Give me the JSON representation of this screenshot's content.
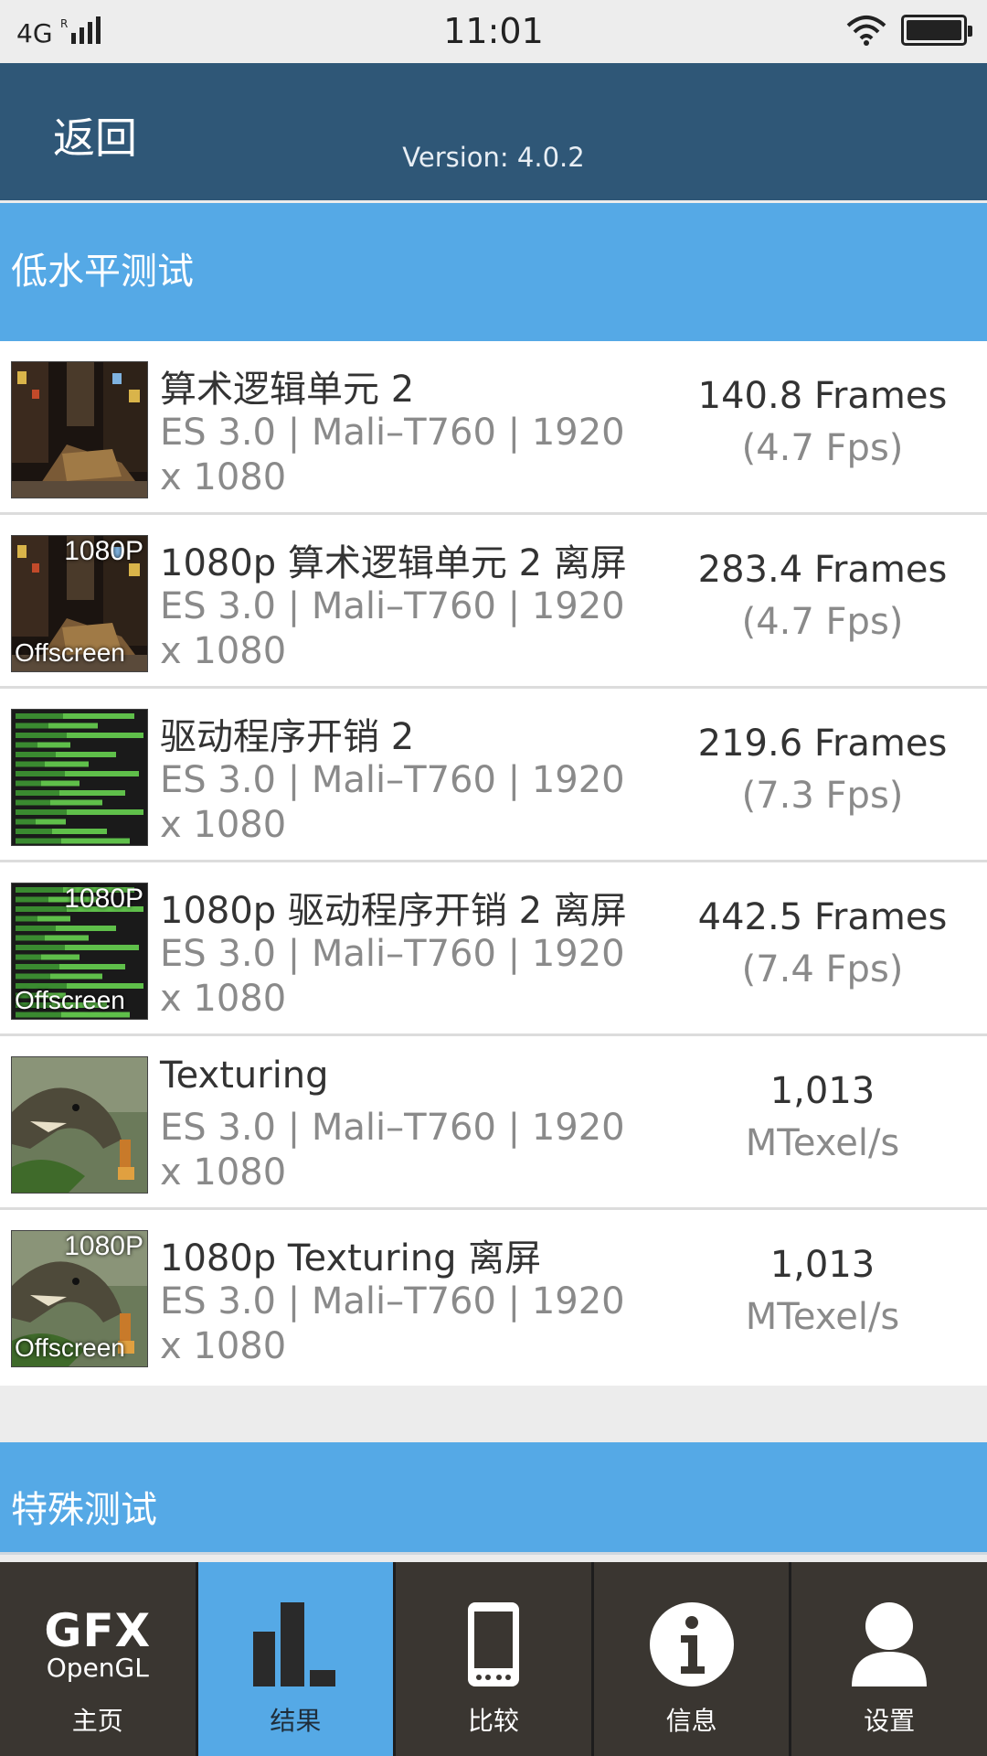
{
  "status": {
    "network": "4G",
    "time": "11:01"
  },
  "header": {
    "back_label": "返回",
    "version": "Version: 4.0.2"
  },
  "section_low": "低水平测试",
  "tests": [
    {
      "name": "算术逻辑单元 2",
      "spec": "ES 3.0 | Mali–T760 | 1920 x 1080",
      "score_main": "140.8 Frames",
      "score_sub": "(4.7 Fps)",
      "thumb": "city",
      "badge_top": "",
      "badge_bottom": ""
    },
    {
      "name": "1080p 算术逻辑单元 2 离屏",
      "spec": "ES 3.0 | Mali–T760 | 1920 x 1080",
      "score_main": "283.4 Frames",
      "score_sub": "(4.7 Fps)",
      "thumb": "city",
      "badge_top": "1080P",
      "badge_bottom": "Offscreen"
    },
    {
      "name": "驱动程序开销 2",
      "spec": "ES 3.0 | Mali–T760 | 1920 x 1080",
      "score_main": "219.6 Frames",
      "score_sub": "(7.3 Fps)",
      "thumb": "bars",
      "badge_top": "",
      "badge_bottom": ""
    },
    {
      "name": "1080p 驱动程序开销 2 离屏",
      "spec": "ES 3.0 | Mali–T760 | 1920 x 1080",
      "score_main": "442.5 Frames",
      "score_sub": "(7.4 Fps)",
      "thumb": "bars",
      "badge_top": "1080P",
      "badge_bottom": "Offscreen"
    },
    {
      "name": "Texturing",
      "spec": "ES 3.0 | Mali–T760 | 1920 x 1080",
      "score_main": "1,013",
      "score_sub": "MTexel/s",
      "thumb": "dino",
      "badge_top": "",
      "badge_bottom": ""
    },
    {
      "name": "1080p Texturing 离屏",
      "spec": "ES 3.0 | Mali–T760 | 1920 x 1080",
      "score_main": "1,013",
      "score_sub": "MTexel/s",
      "thumb": "dino",
      "badge_top": "1080P",
      "badge_bottom": "Offscreen"
    }
  ],
  "section_special": "特殊测试",
  "tabs": [
    {
      "label": "主页",
      "icon": "gfx-logo-icon",
      "logo_top": "GFX",
      "logo_bottom": "OpenGL",
      "active": false
    },
    {
      "label": "结果",
      "icon": "bar-chart-icon",
      "active": true
    },
    {
      "label": "比较",
      "icon": "phone-icon",
      "active": false
    },
    {
      "label": "信息",
      "icon": "info-icon",
      "active": false
    },
    {
      "label": "设置",
      "icon": "user-icon",
      "active": false
    }
  ],
  "colors": {
    "header": "#2f5777",
    "accent": "#55a9e6",
    "tabbar": "#3a3631"
  }
}
